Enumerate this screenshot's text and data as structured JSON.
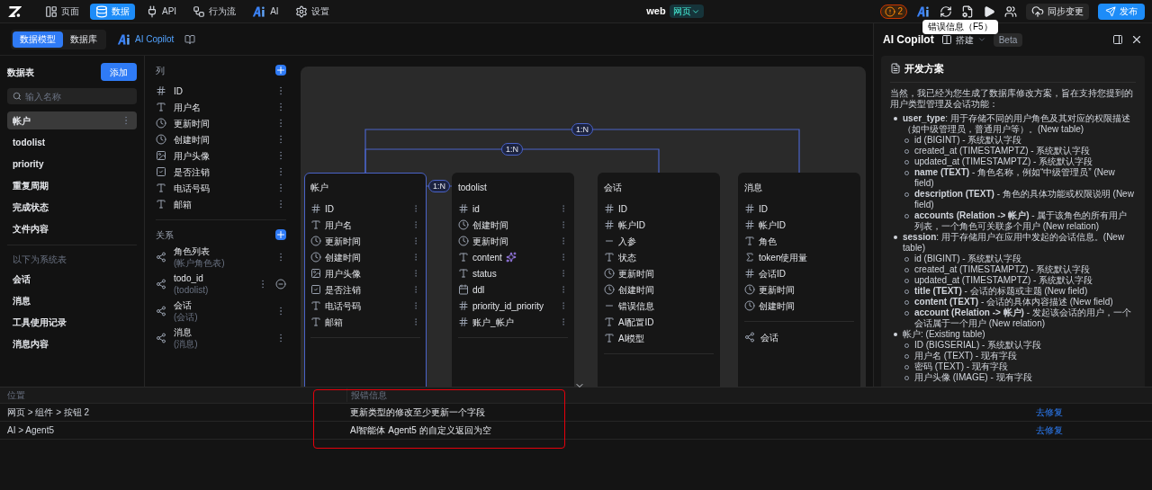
{
  "nav": {
    "items": [
      {
        "label": "页面",
        "kind": "page",
        "selected": false
      },
      {
        "label": "数据",
        "kind": "data",
        "selected": true
      },
      {
        "label": "API",
        "kind": "api",
        "selected": false
      },
      {
        "label": "行为流",
        "kind": "flow",
        "selected": false
      },
      {
        "label": "AI",
        "kind": "ai",
        "selected": false
      },
      {
        "label": "设置",
        "kind": "settings",
        "selected": false
      }
    ]
  },
  "app": {
    "name": "web",
    "mode": "网页"
  },
  "toolbar": {
    "error_count": "2",
    "sync": "同步变更",
    "publish": "发布"
  },
  "tooltip": "错误信息（F5）",
  "subheader": {
    "tabs": [
      {
        "label": "数据模型",
        "selected": true
      },
      {
        "label": "数据库",
        "selected": false
      }
    ],
    "copilot": "AI Copilot"
  },
  "tables_panel": {
    "title": "数据表",
    "add": "添加",
    "search_placeholder": "输入名称",
    "tables": [
      {
        "name": "帐户",
        "selected": true
      },
      {
        "name": "todolist",
        "selected": false
      },
      {
        "name": "priority",
        "selected": false
      },
      {
        "name": "重复周期",
        "selected": false
      },
      {
        "name": "完成状态",
        "selected": false
      },
      {
        "name": "文件内容",
        "selected": false
      }
    ],
    "system_label": "以下为系统表",
    "system_tables": [
      {
        "name": "会话",
        "selected": false
      },
      {
        "name": "消息",
        "selected": false
      },
      {
        "name": "工具使用记录",
        "selected": false
      },
      {
        "name": "消息内容",
        "selected": false
      }
    ]
  },
  "fields_panel": {
    "columns_title": "列",
    "columns": [
      {
        "name": "ID",
        "kind": "id"
      },
      {
        "name": "用户名",
        "kind": "text"
      },
      {
        "name": "更新时间",
        "kind": "time"
      },
      {
        "name": "创建时间",
        "kind": "time"
      },
      {
        "name": "用户头像",
        "kind": "image"
      },
      {
        "name": "是否注销",
        "kind": "bool"
      },
      {
        "name": "电话号码",
        "kind": "text"
      },
      {
        "name": "邮箱",
        "kind": "text"
      }
    ],
    "relations_title": "关系",
    "relations": [
      {
        "name": "角色列表",
        "target": "(帐户角色表)",
        "removable": false
      },
      {
        "name": "todo_id",
        "target": "(todolist)",
        "removable": true
      },
      {
        "name": "会话",
        "target": "(会话)",
        "removable": false
      },
      {
        "name": "消息",
        "target": "(消息)",
        "removable": false
      }
    ]
  },
  "diagram": {
    "links": [
      {
        "label": "1:N"
      },
      {
        "label": "1:N"
      },
      {
        "label": "1:N"
      }
    ],
    "tables": [
      {
        "name": "帐户",
        "selected": true,
        "editable": true,
        "fields": [
          {
            "name": "ID",
            "kind": "id",
            "marked": false
          },
          {
            "name": "用户名",
            "kind": "text",
            "marked": false
          },
          {
            "name": "更新时间",
            "kind": "time",
            "marked": false
          },
          {
            "name": "创建时间",
            "kind": "time",
            "marked": false
          },
          {
            "name": "用户头像",
            "kind": "image",
            "marked": false
          },
          {
            "name": "是否注销",
            "kind": "bool",
            "marked": false
          },
          {
            "name": "电话号码",
            "kind": "text",
            "marked": false
          },
          {
            "name": "邮箱",
            "kind": "text",
            "marked": false
          }
        ]
      },
      {
        "name": "todolist",
        "selected": false,
        "editable": true,
        "fields": [
          {
            "name": "id",
            "kind": "id",
            "marked": false
          },
          {
            "name": "创建时间",
            "kind": "time",
            "marked": false
          },
          {
            "name": "更新时间",
            "kind": "time",
            "marked": false
          },
          {
            "name": "content",
            "kind": "text",
            "marked": true
          },
          {
            "name": "status",
            "kind": "text",
            "marked": false
          },
          {
            "name": "ddl",
            "kind": "date",
            "marked": false
          },
          {
            "name": "priority_id_priority",
            "kind": "id",
            "marked": false
          },
          {
            "name": "账户_帐户",
            "kind": "id",
            "marked": false
          }
        ]
      },
      {
        "name": "会话",
        "selected": false,
        "editable": false,
        "fields": [
          {
            "name": "ID",
            "kind": "id",
            "marked": false
          },
          {
            "name": "帐户ID",
            "kind": "id",
            "marked": false
          },
          {
            "name": "入参",
            "kind": "param",
            "marked": false
          },
          {
            "name": "状态",
            "kind": "text",
            "marked": false
          },
          {
            "name": "更新时间",
            "kind": "time",
            "marked": false
          },
          {
            "name": "创建时间",
            "kind": "time",
            "marked": false
          },
          {
            "name": "错误信息",
            "kind": "param",
            "marked": false
          },
          {
            "name": "AI配置ID",
            "kind": "text",
            "marked": false
          },
          {
            "name": "AI模型",
            "kind": "text",
            "marked": false
          }
        ]
      },
      {
        "name": "消息",
        "selected": false,
        "editable": false,
        "fields": [
          {
            "name": "ID",
            "kind": "id",
            "marked": false
          },
          {
            "name": "帐户ID",
            "kind": "id",
            "marked": false
          },
          {
            "name": "角色",
            "kind": "text",
            "marked": false
          },
          {
            "name": "token使用量",
            "kind": "number",
            "marked": false
          },
          {
            "name": "会话ID",
            "kind": "id",
            "marked": false
          },
          {
            "name": "更新时间",
            "kind": "time",
            "marked": false
          },
          {
            "name": "创建时间",
            "kind": "time",
            "marked": false
          }
        ],
        "relations": [
          {
            "name": "会话"
          }
        ]
      }
    ]
  },
  "copilot": {
    "title": "AI Copilot",
    "mode": "搭建",
    "badge": "Beta",
    "section_title": "开发方案",
    "intro": "当然，我已经为您生成了数据库修改方案，旨在支持您提到的用户类型管理及会话功能：",
    "items": [
      {
        "text": "**user_type**: 用于存储不同的用户角色及其对应的权限描述（如中级管理员，普通用户等）。(New table)",
        "children": [
          {
            "text": "id (BIGINT) - 系统默认字段"
          },
          {
            "text": "created_at (TIMESTAMPTZ) - 系统默认字段"
          },
          {
            "text": "updated_at (TIMESTAMPTZ) - 系统默认字段"
          },
          {
            "text": "**name (TEXT)** - 角色名称，例如“中级管理员” (New field)"
          },
          {
            "text": "**description (TEXT)** - 角色的具体功能或权限说明 (New field)"
          },
          {
            "text": "**accounts (Relation -> 帐户)** - 属于该角色的所有用户列表，一个角色可关联多个用户 (New relation)"
          }
        ]
      },
      {
        "text": "**session**: 用于存储用户在应用中发起的会话信息。(New table)",
        "children": [
          {
            "text": "id (BIGINT) - 系统默认字段"
          },
          {
            "text": "created_at (TIMESTAMPTZ) - 系统默认字段"
          },
          {
            "text": "updated_at (TIMESTAMPTZ) - 系统默认字段"
          },
          {
            "text": "**title (TEXT)** - 会话的标题或主题 (New field)"
          },
          {
            "text": "**content (TEXT)** - 会话的具体内容描述 (New field)"
          },
          {
            "text": "**account (Relation -> 帐户)** - 发起该会话的用户，一个会话属于一个用户 (New relation)"
          }
        ]
      },
      {
        "text": "帐户: (Existing table)",
        "children": [
          {
            "text": "ID (BIGSERIAL) - 系统默认字段"
          },
          {
            "text": "用户名 (TEXT) - 现有字段"
          },
          {
            "text": "密码 (TEXT) - 现有字段"
          },
          {
            "text": "用户头像 (IMAGE) - 现有字段"
          }
        ]
      }
    ]
  },
  "errors": {
    "columns": [
      "位置",
      "报错信息"
    ],
    "rows": [
      {
        "location": "网页 > 组件 > 按钮 2",
        "message": "更新类型的修改至少更新一个字段",
        "action": "去修复"
      },
      {
        "location": "AI > Agent5",
        "message": "AI智能体 Agent5 的自定义返回为空",
        "action": "去修复"
      }
    ]
  }
}
